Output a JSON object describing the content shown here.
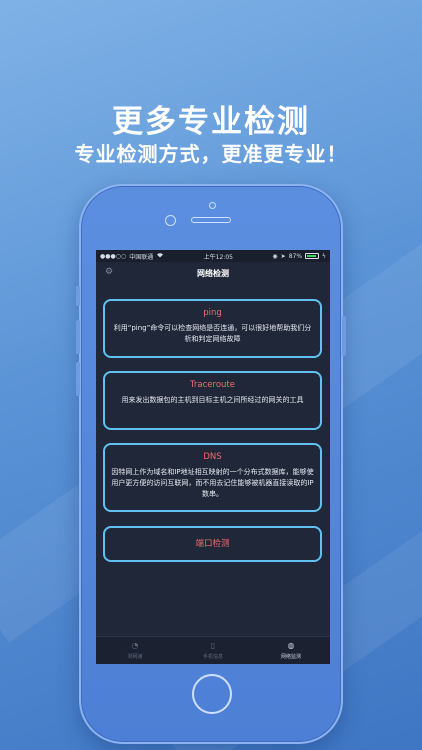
{
  "promo": {
    "headline": "更多专业检测",
    "subline": "专业检测方式，更准更专业！"
  },
  "statusbar": {
    "signal": "●●●○○",
    "carrier": "中国联通",
    "wifi_icon": "wifi-icon",
    "time": "上午12:05",
    "battery_percent": "87%"
  },
  "navbar": {
    "title": "网络检测",
    "settings_icon": "gear-icon"
  },
  "cards": [
    {
      "title": "ping",
      "desc": "利用“ping”命令可以检查网络是否连通，可以很好地帮助我们分析和判定网络故障"
    },
    {
      "title": "Traceroute",
      "desc": "用来发出数据包的主机到目标主机之间所经过的网关的工具"
    },
    {
      "title": "DNS",
      "desc": "因特网上作为域名和IP地址相互映射的一个分布式数据库，能够使用户更方便的访问互联网，而不用去记住能够被机器直接读取的IP数串。"
    },
    {
      "title": "端口检测",
      "desc": ""
    }
  ],
  "tabs": [
    {
      "label": "测网速",
      "icon": "speed-icon"
    },
    {
      "label": "手机信息",
      "icon": "phone-icon"
    },
    {
      "label": "网络监测",
      "icon": "globe-icon"
    }
  ],
  "colors": {
    "accent_border": "#5fc2f0",
    "title_red": "#ef6d6d",
    "screen_bg": "#202738"
  }
}
